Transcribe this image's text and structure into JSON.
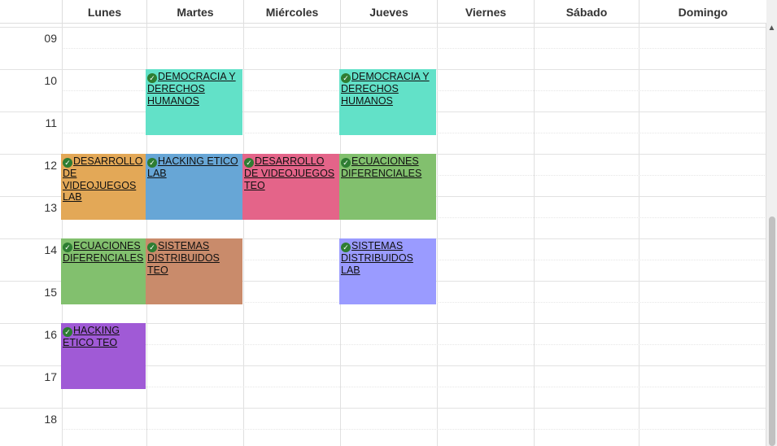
{
  "days": [
    "Lunes",
    "Martes",
    "Miércoles",
    "Jueves",
    "Viernes",
    "Sábado",
    "Domingo"
  ],
  "hours": [
    "09",
    "10",
    "11",
    "12",
    "13",
    "14",
    "15",
    "16",
    "17",
    "18"
  ],
  "events": [
    {
      "day": 1,
      "start": 10,
      "end": 11.6,
      "title": "DEMOCRACIA Y DERECHOS HUMANOS",
      "color": "#62e1c8",
      "done": true
    },
    {
      "day": 3,
      "start": 10,
      "end": 11.6,
      "title": "DEMOCRACIA Y DERECHOS HUMANOS",
      "color": "#62e1c8",
      "done": true
    },
    {
      "day": 0,
      "start": 12,
      "end": 13.6,
      "title": "DESARROLLO DE VIDEOJUEGOS LAB",
      "color": "#e3a857",
      "done": true
    },
    {
      "day": 1,
      "start": 12,
      "end": 13.6,
      "title": "HACKING ETICO LAB",
      "color": "#67a6d6",
      "done": true
    },
    {
      "day": 2,
      "start": 12,
      "end": 13.6,
      "title": "DESARROLLO DE VIDEOJUEGOS TEO",
      "color": "#e46489",
      "done": true
    },
    {
      "day": 3,
      "start": 12,
      "end": 13.6,
      "title": "ECUACIONES DIFERENCIALES",
      "color": "#82c06e",
      "done": true
    },
    {
      "day": 0,
      "start": 14,
      "end": 15.6,
      "title": "ECUACIONES DIFERENCIALES",
      "color": "#82c06e",
      "done": true
    },
    {
      "day": 1,
      "start": 14,
      "end": 15.6,
      "title": "SISTEMAS DISTRIBUIDOS TEO",
      "color": "#c98b6b",
      "done": true
    },
    {
      "day": 3,
      "start": 14,
      "end": 15.6,
      "title": "SISTEMAS DISTRIBUIDOS LAB",
      "color": "#9a9bff",
      "done": true
    },
    {
      "day": 0,
      "start": 16,
      "end": 17.6,
      "title": "HACKING ETICO TEO",
      "color": "#a05ad6",
      "done": true
    }
  ]
}
